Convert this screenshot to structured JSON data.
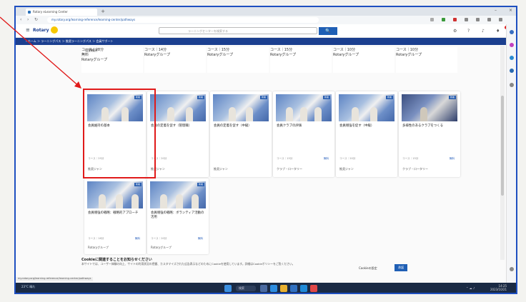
{
  "browser": {
    "tab_title": "Rotary eLearning Center",
    "new_tab": "+",
    "url": "my.rotary.org/learning-reference/learning-center/pathways",
    "nav_back": "‹",
    "nav_forward": "›",
    "nav_reload": "↻",
    "min": "–",
    "close": "×",
    "status_url": "my.rotary.org/learning-reference/learning-center/pathways"
  },
  "site": {
    "brand": "Rotary",
    "search_placeholder": "ラーニングセンターを検索する",
    "search_button": "🔍",
    "breadcrumb": "‹ ホーム ＞ ラーニングパス ＞ 推奨ラーニングパス ＞ 会員サポート"
  },
  "top_row": [
    {
      "title": "役割検討",
      "meta": "コース｜28分",
      "price": "無料",
      "foot": "Rotaryグループ"
    },
    {
      "meta": "コース｜14分",
      "foot": "Rotaryグループ"
    },
    {
      "meta": "コース｜15分",
      "foot": "Rotaryグループ"
    },
    {
      "meta": "コース｜15分",
      "foot": "Rotaryグループ"
    },
    {
      "meta": "コース｜10分",
      "foot": "Rotaryグループ"
    },
    {
      "meta": "コース｜10分",
      "foot": "Rotaryグループ"
    }
  ],
  "cards": [
    {
      "badge": "新着",
      "title": "会員維持の基本",
      "meta": "コース｜25分",
      "price": "",
      "foot": "推奨ジャン"
    },
    {
      "badge": "新着",
      "title": "会員の定着を促す（管理職）",
      "meta": "コース｜20分",
      "price": "",
      "foot": "推奨ジャン"
    },
    {
      "badge": "新着",
      "title": "会員の定着を促す（中級）",
      "meta": "",
      "price": "",
      "foot": "推奨ジャン"
    },
    {
      "badge": "新着",
      "title": "会員クラブの評価",
      "meta": "コース｜15分",
      "price": "無料",
      "foot": "クラブ・ロータリー"
    },
    {
      "badge": "新着",
      "title": "会員増強を促す（中級）",
      "meta": "コース｜20分",
      "price": "",
      "foot": "推奨ジャン"
    },
    {
      "badge": "新着",
      "title": "多様性のあるクラブをつくる",
      "meta": "コース｜15分",
      "price": "無料",
      "foot": "クラブ・ロータリー"
    },
    {
      "badge": "新着",
      "title": "会員増強の戦略：戦略的アプローチ",
      "meta": "コース｜16分",
      "price": "無料",
      "foot": "Rotaryグループ"
    },
    {
      "badge": "新着",
      "title": "会員増強の戦略：ボランティア活動の活用",
      "meta": "コース｜20分",
      "price": "無料",
      "foot": "Rotaryグループ"
    }
  ],
  "cookie": {
    "title": "Cookieに関連することをお知らせください",
    "body": "本サイトでは、ユーザー体験の向上、サイトの利用状況の把握、カスタマイズされた広告表示などのためにCookieを使用しています。詳細はCookieポリシーをご覧ください。",
    "settings": "Cookieの設定",
    "accept": "承諾"
  },
  "taskbar": {
    "weather": "23°C 晴れ",
    "search": "検索",
    "time": "14:25",
    "date": "2023/10/21"
  },
  "colors": {
    "accent": "#1f5fb5",
    "highlight": "#e01a1a",
    "crumb_bg": "#1b3f8f"
  }
}
